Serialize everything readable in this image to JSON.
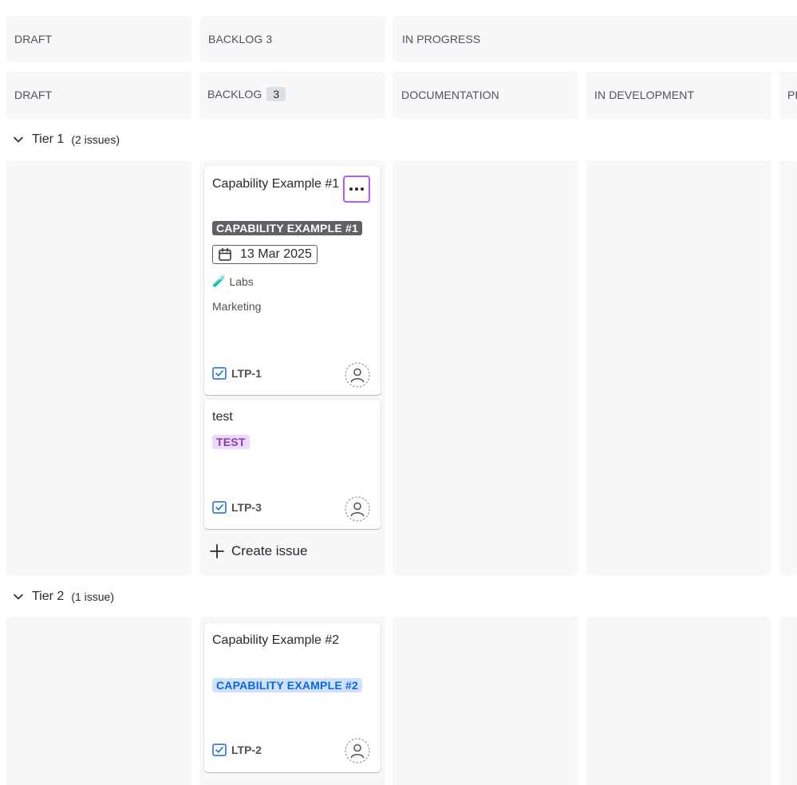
{
  "top_headers": [
    "DRAFT",
    "BACKLOG 3",
    "IN PROGRESS"
  ],
  "columns": [
    {
      "label": "DRAFT"
    },
    {
      "label": "BACKLOG",
      "count": "3"
    },
    {
      "label": "DOCUMENTATION"
    },
    {
      "label": "IN DEVELOPMENT"
    },
    {
      "label": "PE"
    }
  ],
  "groups": [
    {
      "name": "Tier 1",
      "count": "(2 issues)"
    },
    {
      "name": "Tier 2",
      "count": "(1 issue)"
    }
  ],
  "cards": [
    {
      "title": "Capability Example #1",
      "label": "CAPABILITY EXAMPLE #1",
      "date": "13 Mar 2025",
      "team": "Labs",
      "team_emoji": "🧪",
      "category": "Marketing",
      "key": "LTP-1"
    },
    {
      "title": "test",
      "label": "TEST",
      "key": "LTP-3"
    },
    {
      "title": "Capability Example #2",
      "label": "CAPABILITY EXAMPLE #2",
      "key": "LTP-2"
    }
  ],
  "create_issue": "Create issue",
  "colors": {
    "column_bg": "#f7f8f9",
    "lozenge_dark": "#5e6166",
    "lozenge_purple_bg": "#eed7fc",
    "lozenge_purple_text": "#803fa5",
    "lozenge_blue_bg": "#cfe1fd",
    "lozenge_blue_text": "#0c66e4",
    "focus_ring": "#b55ce8",
    "task_icon": "#1868db"
  }
}
